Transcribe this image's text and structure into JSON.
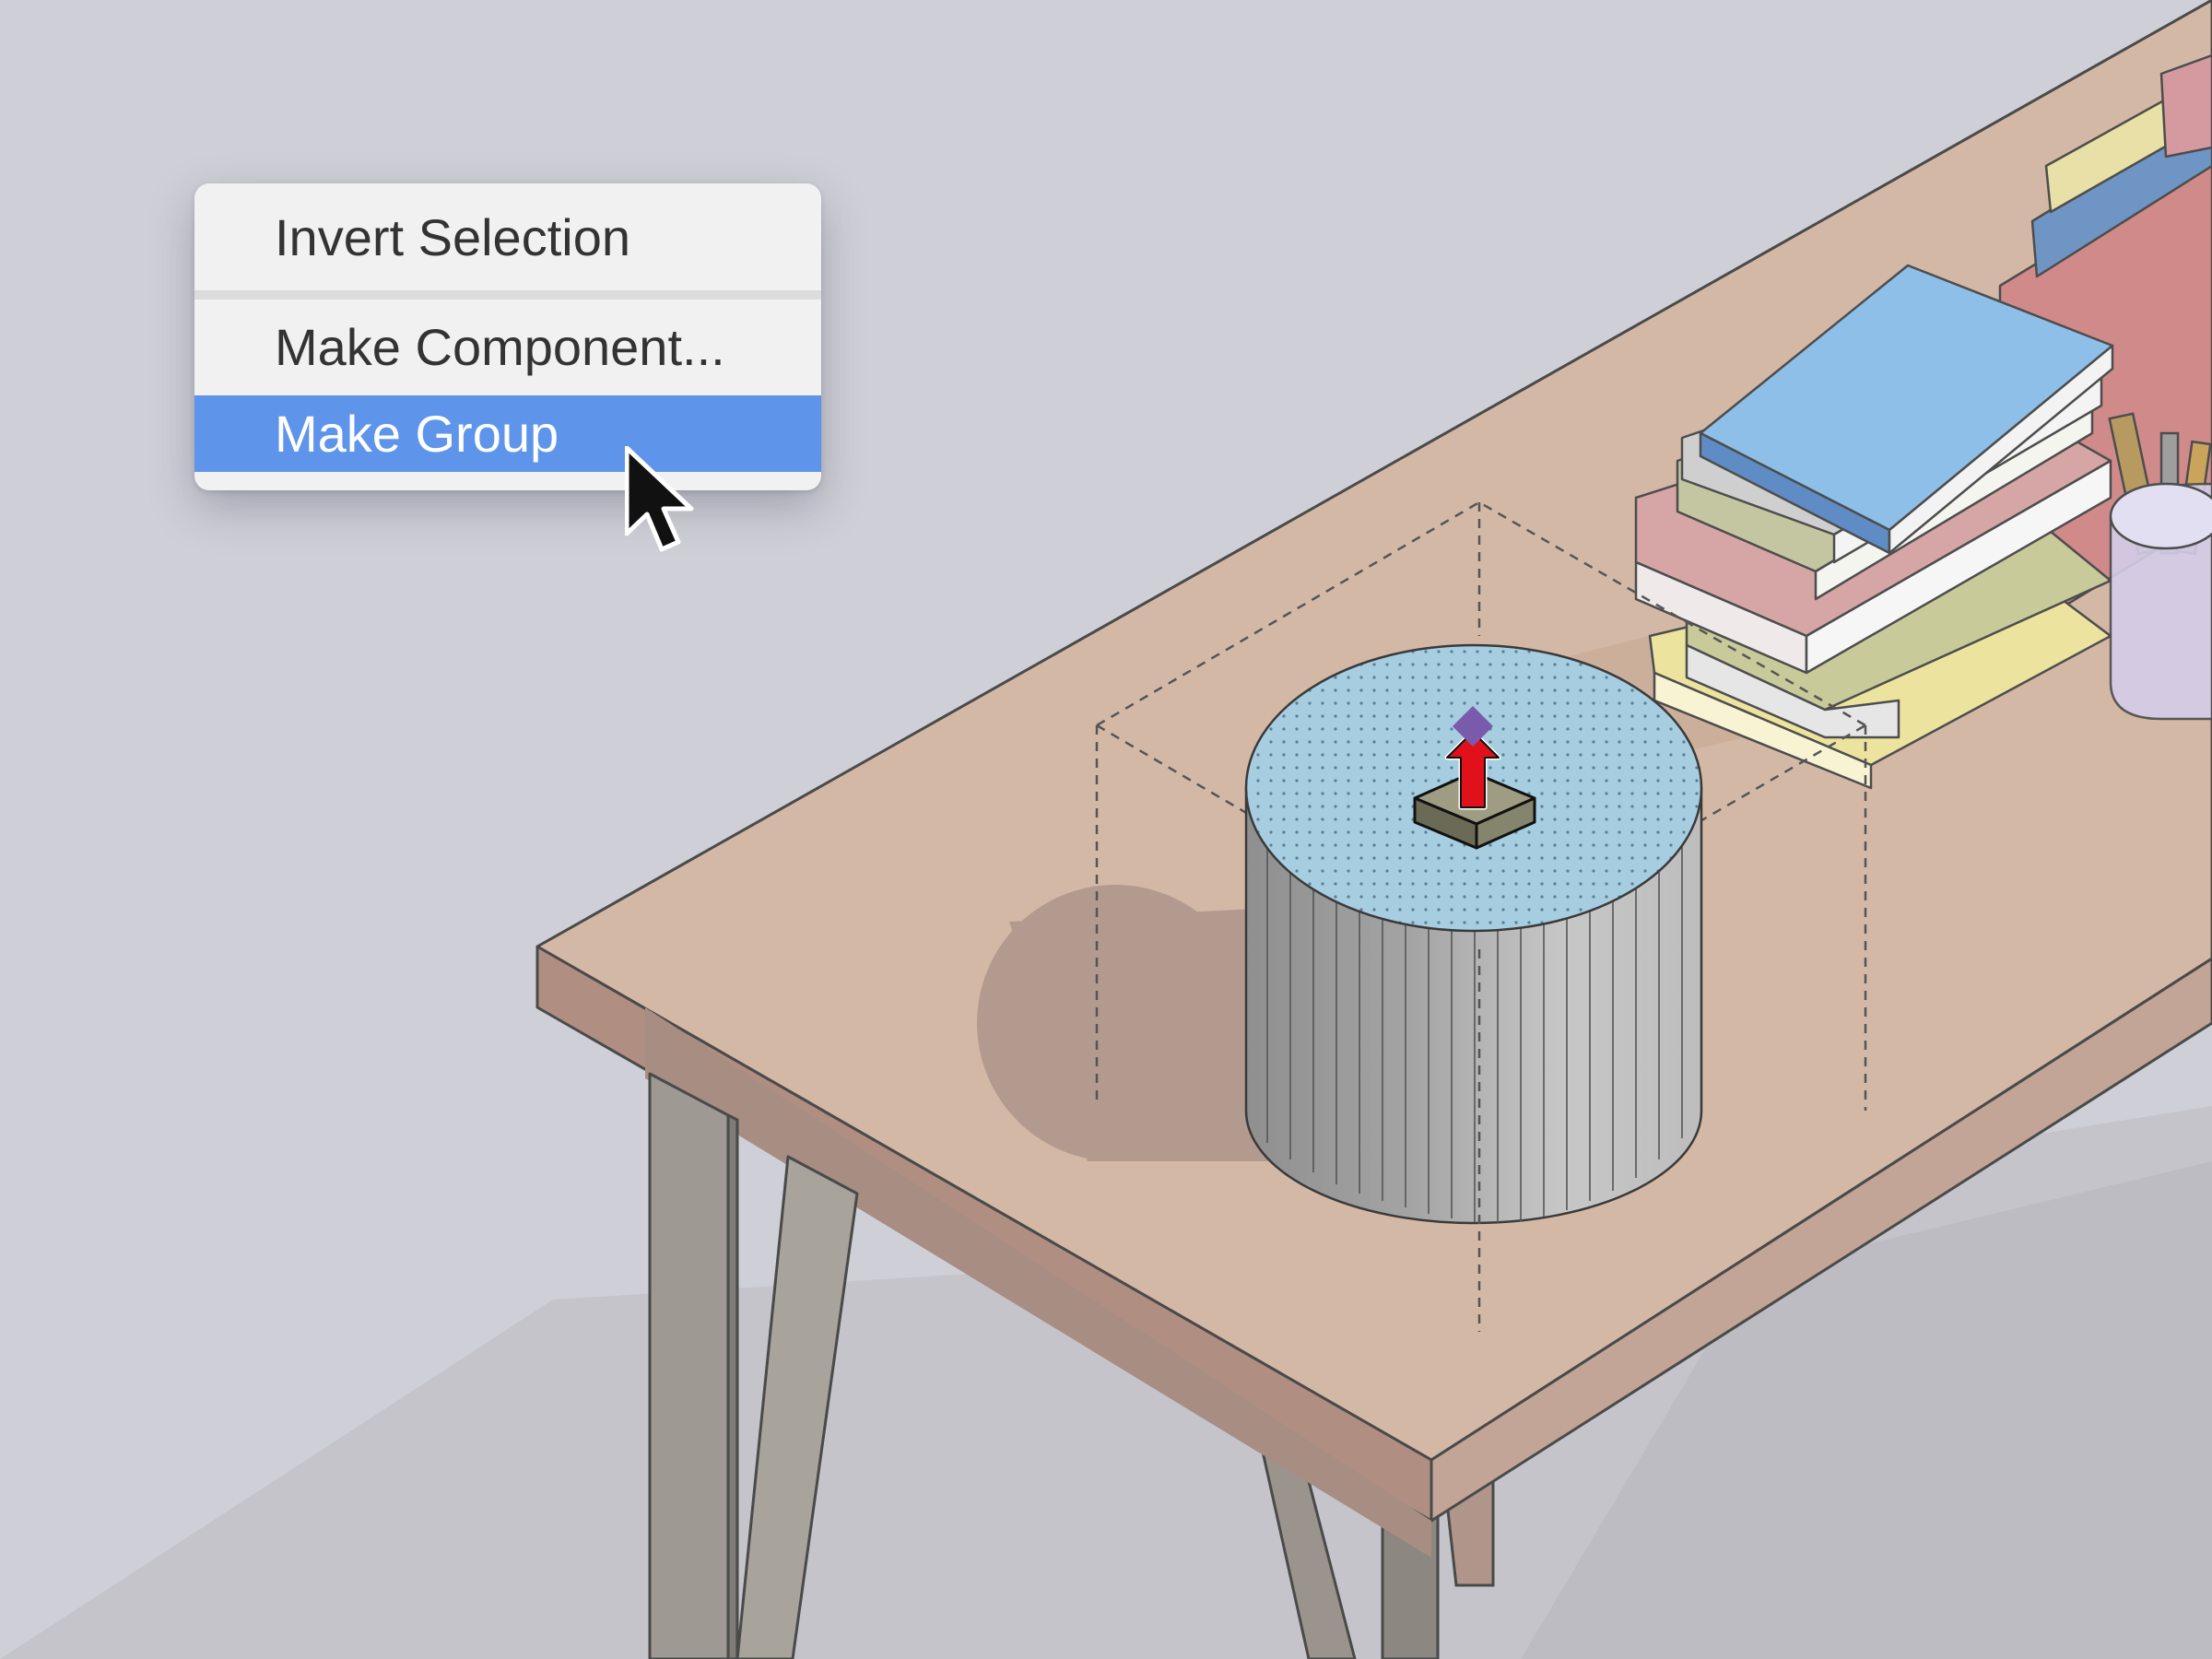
{
  "context_menu": {
    "items": [
      {
        "label": "Invert Selection",
        "state": "normal"
      },
      {
        "label": "Make Component...",
        "state": "normal"
      },
      {
        "label": "Make Group",
        "state": "highlighted"
      }
    ],
    "highlight_color": "#5e95ea"
  },
  "scene": {
    "background_color": "#cfd0d7",
    "selected_object": "cylinder",
    "selection_face_color": "#a6cde0",
    "tool_icon": "push-pull-icon",
    "tabletop_color": "#d4b8a6"
  },
  "cursor": {
    "icon": "arrow-pointer-icon"
  }
}
